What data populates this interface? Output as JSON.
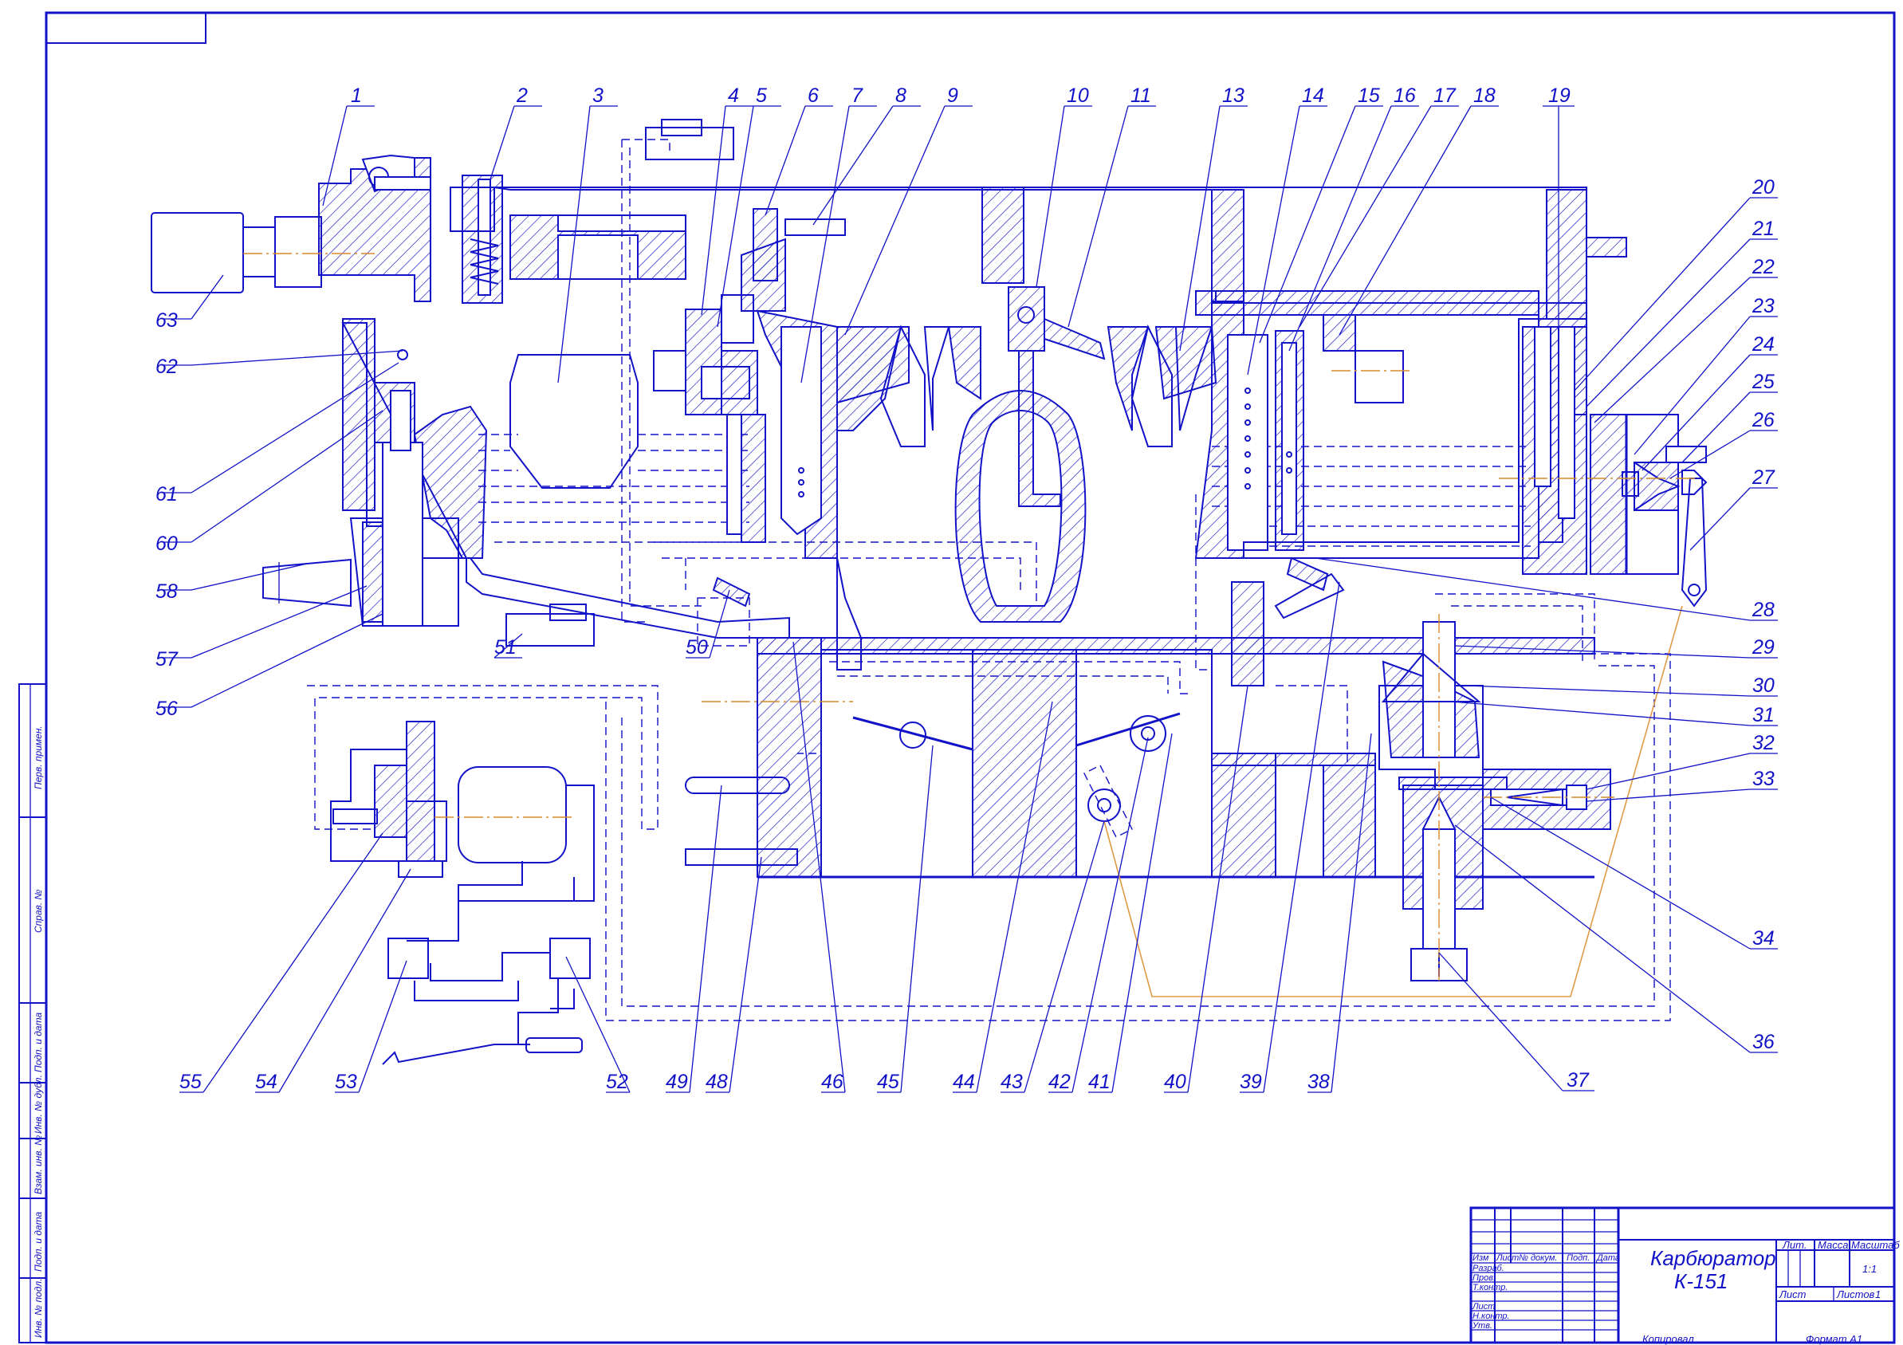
{
  "title_block": {
    "title_line1": "Карбюратор",
    "title_line2": "К-151",
    "sheet_value": "1:1",
    "sheet_label": "Лист",
    "sheets_label": "Листов",
    "sheets_value": "1",
    "lit_label": "Лит.",
    "mass_label": "Масса",
    "scale_label": "Масштаб",
    "col_izm": "Изм",
    "col_list": "Лист",
    "col_doc": "№ докум.",
    "col_sign": "Подп.",
    "col_date": "Дата",
    "razrab": "Разраб.",
    "prov": "Пров.",
    "tkontr": "Т.контр.",
    "list_row": "Лист",
    "nkontr": "Н.контр.",
    "utv": "Утв.",
    "copied": "Копировал",
    "format": "Формат   А1"
  },
  "side_stamp": {
    "perv_primen": "Перв. примен.",
    "sprav": "Справ. №",
    "podp_data_1": "Подп. и дата",
    "inv_dubl": "Инв. № дубл.",
    "vzam_inv": "Взам. инв. №",
    "podp_data_2": "Подп. и дата",
    "inv_podl": "Инв. № подл."
  },
  "callouts": {
    "n1": "1",
    "n2": "2",
    "n3": "3",
    "n4": "4",
    "n5": "5",
    "n6": "6",
    "n7": "7",
    "n8": "8",
    "n9": "9",
    "n10": "10",
    "n11": "11",
    "n13": "13",
    "n14": "14",
    "n15": "15",
    "n16": "16",
    "n17": "17",
    "n18": "18",
    "n19": "19",
    "n20": "20",
    "n21": "21",
    "n22": "22",
    "n23": "23",
    "n24": "24",
    "n25": "25",
    "n26": "26",
    "n27": "27",
    "n28": "28",
    "n29": "29",
    "n30": "30",
    "n31": "31",
    "n32": "32",
    "n33": "33",
    "n34": "34",
    "n36": "36",
    "n37": "37",
    "n38": "38",
    "n39": "39",
    "n40": "40",
    "n41": "41",
    "n42": "42",
    "n43": "43",
    "n44": "44",
    "n45": "45",
    "n46": "46",
    "n48": "48",
    "n49": "49",
    "n50": "50",
    "n51": "51",
    "n52": "52",
    "n53": "53",
    "n54": "54",
    "n55": "55",
    "n56": "56",
    "n57": "57",
    "n58": "58",
    "n60": "60",
    "n61": "61",
    "n62": "62",
    "n63": "63"
  },
  "colors": {
    "line": "#1212c8",
    "axis": "#d98a2a",
    "background": "#ffffff"
  }
}
